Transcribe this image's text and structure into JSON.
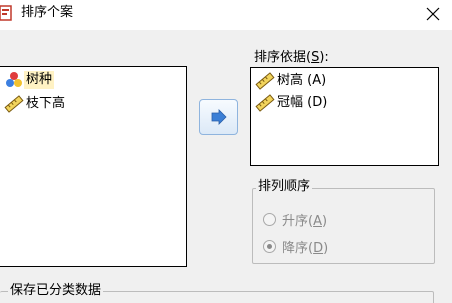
{
  "window": {
    "title": "排序个案",
    "close_glyph": "✕"
  },
  "source_list": {
    "items": [
      {
        "label": "树种",
        "icon": "nominal-variable-icon",
        "selected": true
      },
      {
        "label": "枝下高",
        "icon": "scale-variable-icon",
        "selected": false
      }
    ]
  },
  "move_button": {
    "icon": "right-arrow-icon"
  },
  "sort_by": {
    "caption_prefix": "排序依据(",
    "caption_mnemonic": "S",
    "caption_suffix": "):",
    "items": [
      {
        "label": "树高 (A)",
        "icon": "scale-variable-icon"
      },
      {
        "label": "冠幅 (D)",
        "icon": "scale-variable-icon"
      }
    ]
  },
  "sort_order": {
    "legend": "排列顺序",
    "options": [
      {
        "label_prefix": "升序(",
        "mnemonic": "A",
        "label_suffix": ")",
        "checked": false,
        "enabled": false
      },
      {
        "label_prefix": "降序(",
        "mnemonic": "D",
        "label_suffix": ")",
        "checked": true,
        "enabled": false
      }
    ]
  },
  "save_group": {
    "legend": "保存已分类数据"
  },
  "colors": {
    "selected_item": "#fff2c4",
    "arrow": "#3b7fd6",
    "disabled_text": "#8a8a8a"
  }
}
